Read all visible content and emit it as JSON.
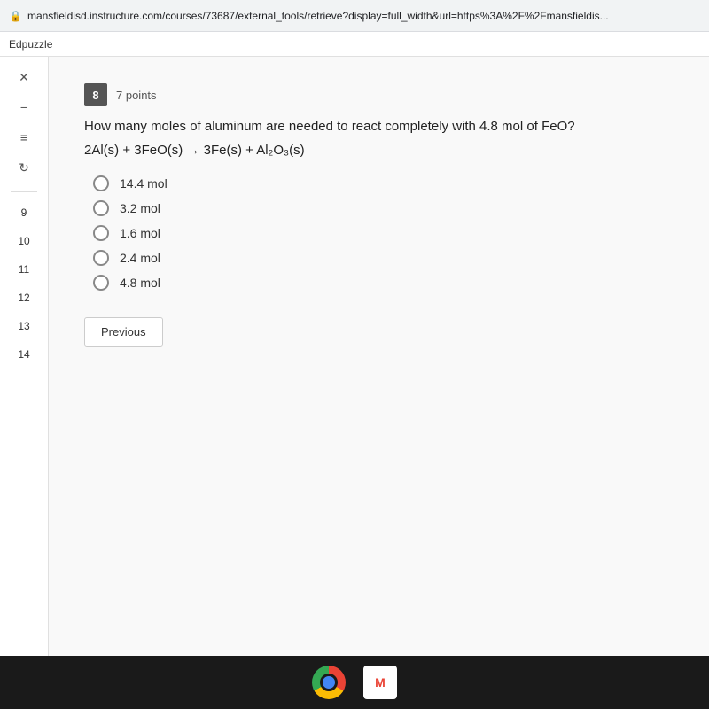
{
  "browser": {
    "url": "mansfieldisd.instructure.com/courses/73687/external_tools/retrieve?display=full_width&url=https%3A%2F%2Fmansfieldis...",
    "lock_icon": "🔒"
  },
  "tab": {
    "label": "Edpuzzle"
  },
  "sidebar": {
    "icons": [
      "✕",
      "−",
      "≡",
      "↻"
    ],
    "nav_numbers": [
      "9",
      "10",
      "11",
      "12",
      "13",
      "14"
    ]
  },
  "question": {
    "number": "8",
    "points": "7 points",
    "text": "How many moles of aluminum are needed to react completely with 4.8 mol of FeO?",
    "equation": "2Al(s) + 3FeO(s) → 3Fe(s) + Al₂O₃(s)",
    "options": [
      {
        "id": "opt1",
        "label": "14.4 mol"
      },
      {
        "id": "opt2",
        "label": "3.2 mol"
      },
      {
        "id": "opt3",
        "label": "1.6 mol"
      },
      {
        "id": "opt4",
        "label": "2.4 mol"
      },
      {
        "id": "opt5",
        "label": "4.8 mol"
      }
    ]
  },
  "buttons": {
    "previous": "Previous"
  },
  "taskbar": {
    "chrome_title": "Chrome",
    "gmail_title": "Gmail",
    "gmail_letter": "M"
  }
}
